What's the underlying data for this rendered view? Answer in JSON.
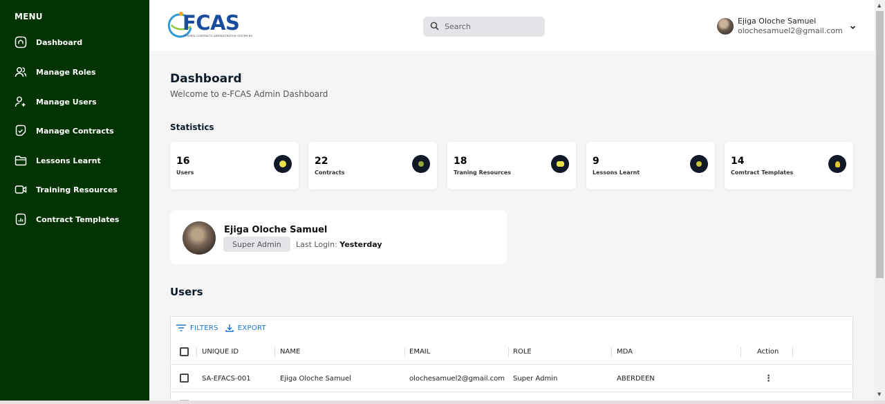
{
  "sidebar": {
    "menu_title": "MENU",
    "items": [
      {
        "label": "Dashboard",
        "icon": "home-icon"
      },
      {
        "label": "Manage Roles",
        "icon": "users-icon"
      },
      {
        "label": "Manage Users",
        "icon": "user-plus-icon"
      },
      {
        "label": "Manage Contracts",
        "icon": "contract-icon"
      },
      {
        "label": "Lessons Learnt",
        "icon": "folder-icon"
      },
      {
        "label": "Training Resources",
        "icon": "video-icon"
      },
      {
        "label": "Contract Templates",
        "icon": "report-icon"
      }
    ]
  },
  "header": {
    "logo_text": "FCAS",
    "logo_tagline": "FEDERAL CONTRACTS ADMINISTRATION SYSTEM NG",
    "search_placeholder": "Search",
    "user_name": "Ejiga Oloche Samuel",
    "user_email": "olochesamuel2@gmail.com"
  },
  "main": {
    "title": "Dashboard",
    "subtitle": "Welcome to e-FCAS Admin Dashboard",
    "statistics_title": "Statistics",
    "stats": [
      {
        "value": "16",
        "label": "Users"
      },
      {
        "value": "22",
        "label": "Contracts"
      },
      {
        "value": "18",
        "label": "Traning Resources"
      },
      {
        "value": "9",
        "label": "Lessons Learnt"
      },
      {
        "value": "14",
        "label": "Comtract Templates"
      }
    ],
    "profile": {
      "name": "Ejiga Oloche Samuel",
      "role_badge": "Super Admin",
      "last_login_label": "Last Login:",
      "last_login_value": "Yesterday"
    },
    "users_title": "Users",
    "table": {
      "filters_label": "FILTERS",
      "export_label": "EXPORT",
      "columns": [
        "UNIQUE ID",
        "NAME",
        "EMAIL",
        "ROLE",
        "MDA",
        "Action"
      ],
      "rows": [
        {
          "unique_id": "SA-EFACS-001",
          "name": "Ejiga Oloche Samuel",
          "email": "olochesamuel2@gmail.com",
          "role": "Super Admin",
          "mda": "ABERDEEN",
          "action": "⋮"
        }
      ]
    }
  },
  "colors": {
    "sidebar_bg": "#003300",
    "accent_blue": "#1976d2",
    "stat_icon_bg": "#111827",
    "stat_icon_dot": "#e8e04a"
  }
}
